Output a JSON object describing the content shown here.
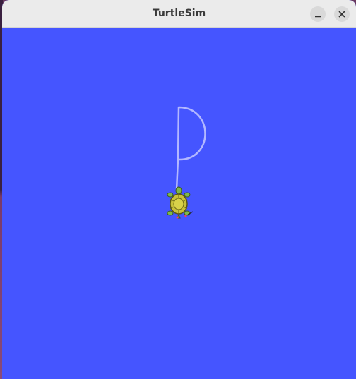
{
  "window": {
    "title": "TurtleSim"
  },
  "titlebar_buttons": [
    {
      "name": "minimize",
      "icon": "minimize-icon"
    },
    {
      "name": "close",
      "icon": "close-icon"
    }
  ],
  "canvas": {
    "background_color": "#4555ff",
    "pen_color": "#b3b8ff",
    "turtle_shell_color": "#c8c23a"
  }
}
